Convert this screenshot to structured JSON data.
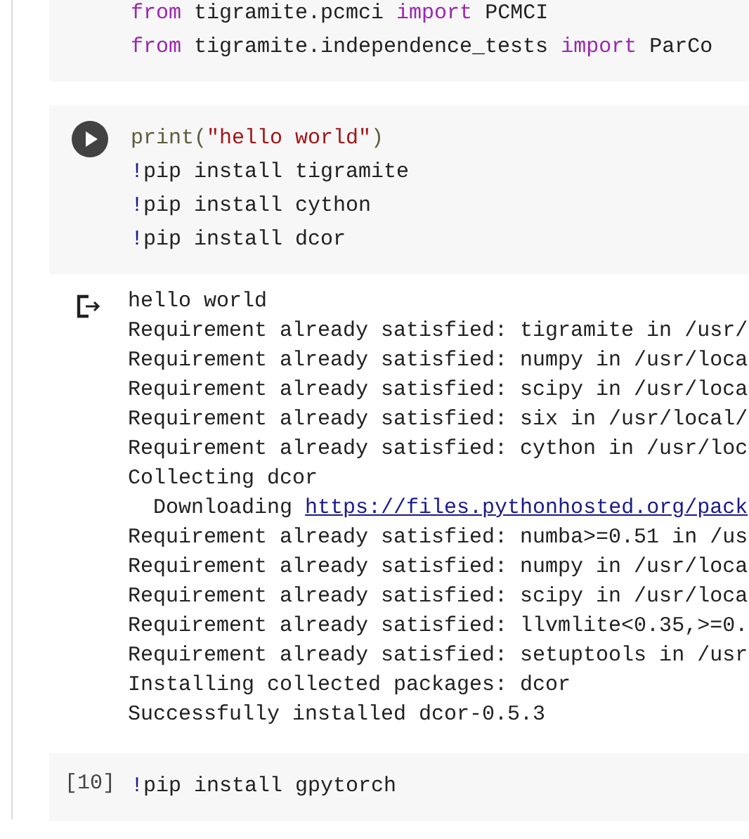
{
  "cells": [
    {
      "kind": "code",
      "run_button": false,
      "lines": [
        [
          {
            "kind": "keyword",
            "text": "from"
          },
          {
            "kind": "plain",
            "text": " tigramite.pcmci "
          },
          {
            "kind": "keyword",
            "text": "import"
          },
          {
            "kind": "plain",
            "text": " PCMCI"
          }
        ],
        [
          {
            "kind": "keyword",
            "text": "from"
          },
          {
            "kind": "plain",
            "text": " tigramite.independence_tests "
          },
          {
            "kind": "keyword",
            "text": "import"
          },
          {
            "kind": "plain",
            "text": " ParCo"
          }
        ]
      ]
    },
    {
      "kind": "code",
      "run_button": true,
      "lines": [
        [
          {
            "kind": "function",
            "text": "print("
          },
          {
            "kind": "string",
            "text": "\"hello world\""
          },
          {
            "kind": "function",
            "text": ")"
          }
        ],
        [
          {
            "kind": "bang",
            "text": "!"
          },
          {
            "kind": "plain",
            "text": "pip install tigramite"
          }
        ],
        [
          {
            "kind": "bang",
            "text": "!"
          },
          {
            "kind": "plain",
            "text": "pip install cython"
          }
        ],
        [
          {
            "kind": "bang",
            "text": "!"
          },
          {
            "kind": "plain",
            "text": "pip install dcor"
          }
        ]
      ],
      "output": [
        {
          "text": "hello world"
        },
        {
          "text": "Requirement already satisfied: tigramite in /usr/"
        },
        {
          "text": "Requirement already satisfied: numpy in /usr/loca"
        },
        {
          "text": "Requirement already satisfied: scipy in /usr/loca"
        },
        {
          "text": "Requirement already satisfied: six in /usr/local/"
        },
        {
          "text": "Requirement already satisfied: cython in /usr/loc"
        },
        {
          "text": "Collecting dcor"
        },
        {
          "text": "  Downloading ",
          "link": "https://files.pythonhosted.org/pack"
        },
        {
          "text": "Requirement already satisfied: numba>=0.51 in /us"
        },
        {
          "text": "Requirement already satisfied: numpy in /usr/loca"
        },
        {
          "text": "Requirement already satisfied: scipy in /usr/loca"
        },
        {
          "text": "Requirement already satisfied: llvmlite<0.35,>=0."
        },
        {
          "text": "Requirement already satisfied: setuptools in /usr"
        },
        {
          "text": "Installing collected packages: dcor"
        },
        {
          "text": "Successfully installed dcor-0.5.3"
        }
      ]
    },
    {
      "kind": "code",
      "prompt": "[10]",
      "run_button": false,
      "lines": [
        [
          {
            "kind": "bang",
            "text": "!"
          },
          {
            "kind": "plain",
            "text": "pip install gpytorch"
          }
        ]
      ]
    }
  ]
}
